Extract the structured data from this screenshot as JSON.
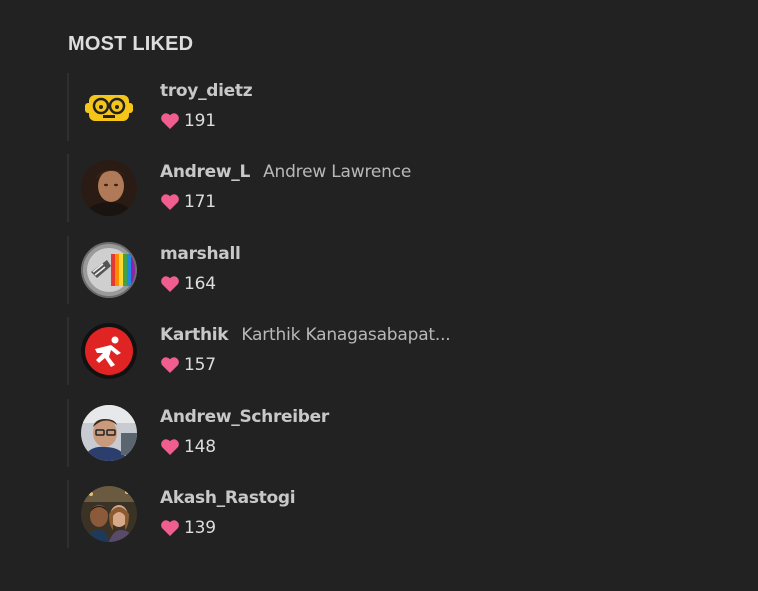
{
  "section": {
    "title": "MOST LIKED"
  },
  "colors": {
    "heart": "#ef5e8f",
    "background": "#222222"
  },
  "users": [
    {
      "username": "troy_dietz",
      "full_name": "",
      "likes": "191",
      "avatar": "yellow-bot-icon"
    },
    {
      "username": "Andrew_L",
      "full_name": "Andrew Lawrence",
      "likes": "171",
      "avatar": "photo-portrait"
    },
    {
      "username": "marshall",
      "full_name": "",
      "likes": "164",
      "avatar": "rainbow-badge"
    },
    {
      "username": "Karthik",
      "full_name": "Karthik Kanagasabapat...",
      "likes": "157",
      "avatar": "red-kick-icon"
    },
    {
      "username": "Andrew_Schreiber",
      "full_name": "",
      "likes": "148",
      "avatar": "photo-portrait"
    },
    {
      "username": "Akash_Rastogi",
      "full_name": "",
      "likes": "139",
      "avatar": "photo-group"
    }
  ]
}
